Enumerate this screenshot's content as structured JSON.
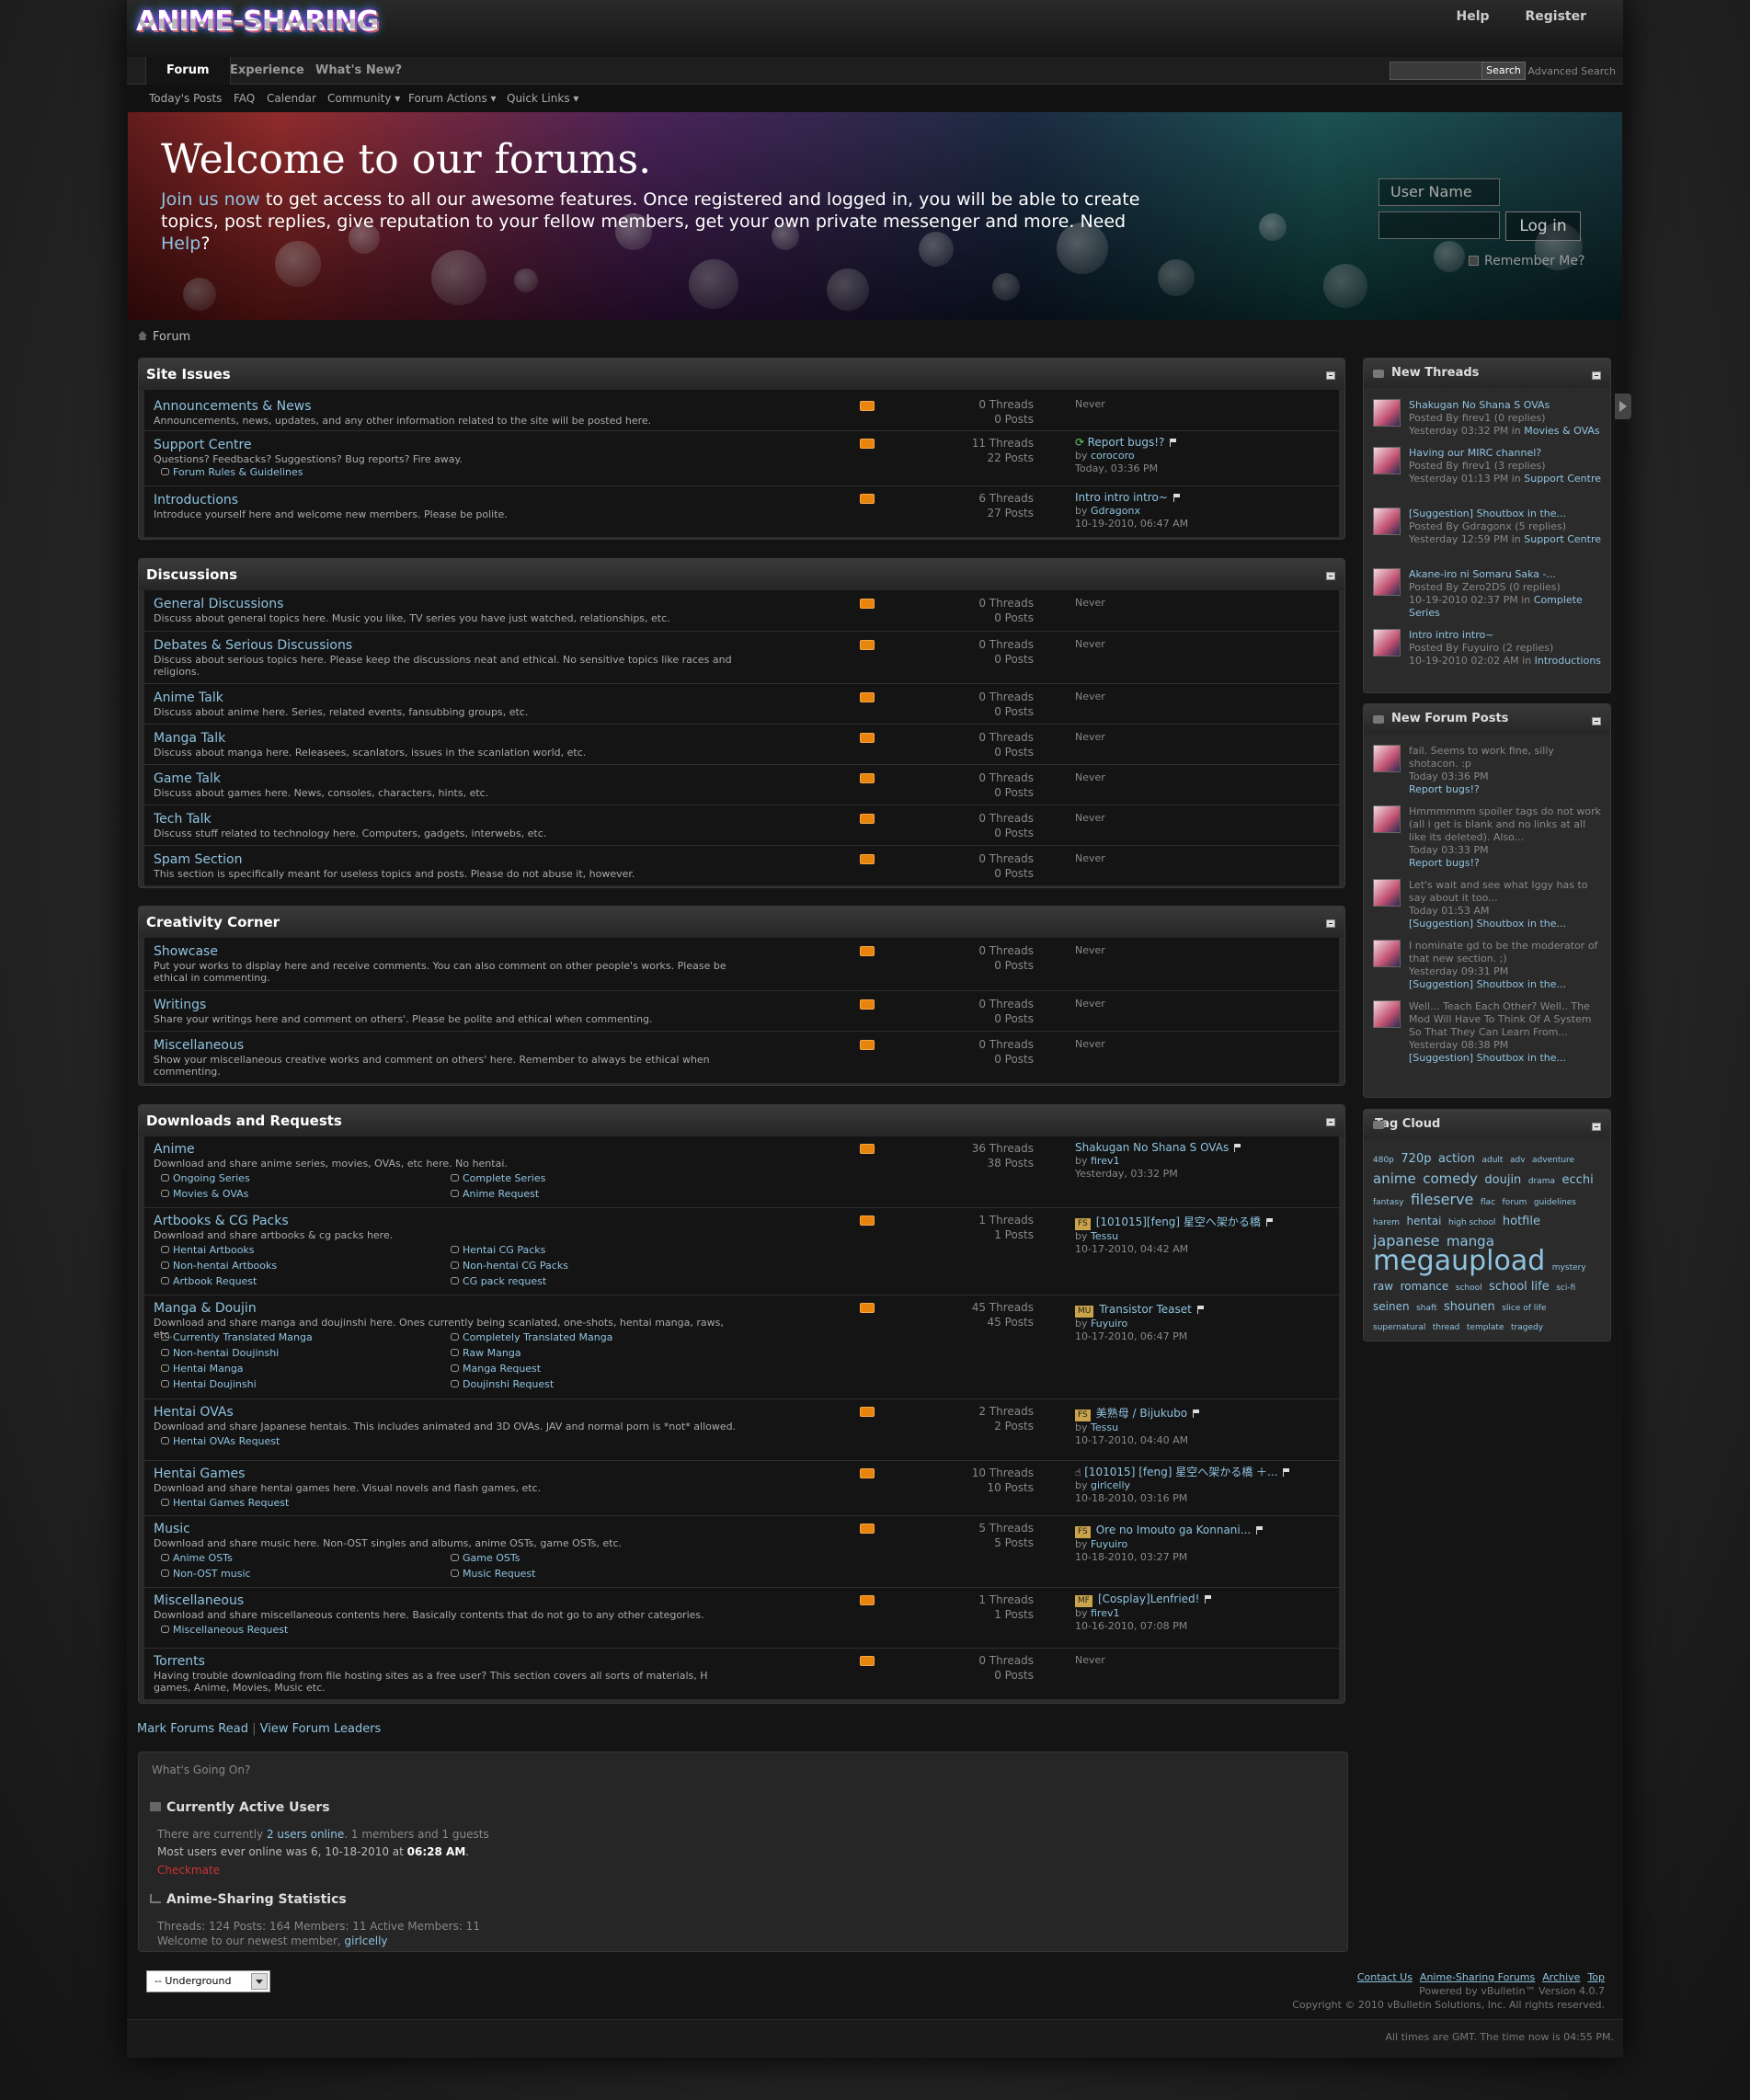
{
  "header": {
    "logo": "ANIME-SHARING",
    "help": "Help",
    "register": "Register"
  },
  "nav": {
    "tabs": [
      {
        "label": "Forum"
      },
      {
        "label": "Experience"
      },
      {
        "label": "What's New?"
      }
    ],
    "search_btn": "Search",
    "advanced": "Advanced Search"
  },
  "subnav": [
    "Today's Posts",
    "FAQ",
    "Calendar",
    "Community ▾",
    "Forum Actions ▾",
    "Quick Links ▾"
  ],
  "banner": {
    "title": "Welcome to our forums.",
    "join": "Join us now",
    "text": " to get access to all our awesome features. Once registered and logged in, you will be able to create topics, post replies, give reputation to your fellow members, get your own private messenger and more. Need ",
    "help": "Help",
    "end": "?",
    "user_placeholder": "User Name",
    "login": "Log in",
    "remember": "Remember Me?"
  },
  "breadcrumb": "Forum",
  "categories": [
    {
      "title": "Site Issues",
      "forums": [
        {
          "name": "Announcements & News",
          "desc": "Announcements, news, updates, and any other information related to the site will be posted here.",
          "threads": "0 Threads",
          "posts": "0 Posts",
          "last": "Never"
        },
        {
          "name": "Support Centre",
          "desc": "Questions? Feedbacks? Suggestions? Bug reports? Fire away.",
          "subs": [
            "Forum Rules & Guidelines"
          ],
          "threads": "11 Threads",
          "posts": "22 Posts",
          "last_title": "Report bugs!?",
          "by": "by ",
          "user": "corocoro",
          "date": "Today, 03:36 PM"
        },
        {
          "name": "Introductions",
          "desc": "Introduce yourself here and welcome new members. Please be polite.",
          "threads": "6 Threads",
          "posts": "27 Posts",
          "last_title": "Intro intro intro~",
          "by": "by ",
          "user": "Gdragonx",
          "date": "10-19-2010, 06:47 AM"
        }
      ]
    },
    {
      "title": "Discussions",
      "forums": [
        {
          "name": "General Discussions",
          "desc": "Discuss about general topics here. Music you like, TV series you have just watched, relationships, etc.",
          "threads": "0 Threads",
          "posts": "0 Posts",
          "last": "Never"
        },
        {
          "name": "Debates & Serious Discussions",
          "desc": "Discuss about serious topics here. Please keep the discussions neat and ethical. No sensitive topics like races and religions.",
          "threads": "0 Threads",
          "posts": "0 Posts",
          "last": "Never"
        },
        {
          "name": "Anime Talk",
          "desc": "Discuss about anime here. Series, related events, fansubbing groups, etc.",
          "threads": "0 Threads",
          "posts": "0 Posts",
          "last": "Never"
        },
        {
          "name": "Manga Talk",
          "desc": "Discuss about manga here. Releasees, scanlators, issues in the scanlation world, etc.",
          "threads": "0 Threads",
          "posts": "0 Posts",
          "last": "Never"
        },
        {
          "name": "Game Talk",
          "desc": "Discuss about games here. News, consoles, characters, hints, etc.",
          "threads": "0 Threads",
          "posts": "0 Posts",
          "last": "Never"
        },
        {
          "name": "Tech Talk",
          "desc": "Discuss stuff related to technology here. Computers, gadgets, interwebs, etc.",
          "threads": "0 Threads",
          "posts": "0 Posts",
          "last": "Never"
        },
        {
          "name": "Spam Section",
          "desc": "This section is specifically meant for useless topics and posts. Please do not abuse it, however.",
          "threads": "0 Threads",
          "posts": "0 Posts",
          "last": "Never"
        }
      ]
    },
    {
      "title": "Creativity Corner",
      "forums": [
        {
          "name": "Showcase",
          "desc": "Put your works to display here and receive comments. You can also comment on other people's works. Please be ethical in commenting.",
          "threads": "0 Threads",
          "posts": "0 Posts",
          "last": "Never"
        },
        {
          "name": "Writings",
          "desc": "Share your writings here and comment on others'. Please be polite and ethical when commenting.",
          "threads": "0 Threads",
          "posts": "0 Posts",
          "last": "Never"
        },
        {
          "name": "Miscellaneous",
          "desc": "Show your miscellaneous creative works and comment on others' here. Remember to always be ethical when commenting.",
          "threads": "0 Threads",
          "posts": "0 Posts",
          "last": "Never"
        }
      ]
    },
    {
      "title": "Downloads and Requests",
      "forums": [
        {
          "name": "Anime",
          "desc": "Download and share anime series, movies, OVAs, etc here. No hentai.",
          "subs": [
            "Ongoing Series",
            "Complete Series",
            "Movies & OVAs",
            "Anime Request"
          ],
          "threads": "36 Threads",
          "posts": "38 Posts",
          "last_title": "Shakugan No Shana S OVAs",
          "by": "by ",
          "user": "firev1",
          "date": "Yesterday, 03:32 PM"
        },
        {
          "name": "Artbooks & CG Packs",
          "desc": "Download and share artbooks & cg packs here.",
          "subs": [
            "Hentai Artbooks",
            "Hentai CG Packs",
            "Non-hentai Artbooks",
            "Non-hentai CG Packs",
            "Artbook Request",
            "CG pack request"
          ],
          "threads": "1 Threads",
          "posts": "1 Posts",
          "prefix": "FS",
          "last_title": "[101015][feng] 星空へ架かる橋",
          "by": "by ",
          "user": "Tessu",
          "date": "10-17-2010, 04:42 AM"
        },
        {
          "name": "Manga & Doujin",
          "desc": "Download and share manga and doujinshi here. Ones currently being scanlated, one-shots, hentai manga, raws, etc.",
          "subs": [
            "Currently Translated Manga",
            "Completely Translated Manga",
            "Non-hentai Doujinshi",
            "Raw Manga",
            "Hentai Manga",
            "Manga Request",
            "Hentai Doujinshi",
            "Doujinshi Request"
          ],
          "threads": "45 Threads",
          "posts": "45 Posts",
          "prefix": "MU",
          "last_title": "Transistor Teaset",
          "by": "by ",
          "user": "Fuyuiro",
          "date": "10-17-2010, 06:47 PM"
        },
        {
          "name": "Hentai OVAs",
          "desc": "Download and share Japanese hentais. This includes animated and 3D OVAs. JAV and normal porn is *not* allowed.",
          "subs": [
            "Hentai OVAs Request"
          ],
          "threads": "2 Threads",
          "posts": "2 Posts",
          "prefix": "FS",
          "last_title": "美熟母 / Bijukubo",
          "by": "by ",
          "user": "Tessu",
          "date": "10-17-2010, 04:40 AM"
        },
        {
          "name": "Hentai Games",
          "desc": "Download and share hentai games here. Visual novels and flash games, etc.",
          "subs": [
            "Hentai Games Request"
          ],
          "threads": "10 Threads",
          "posts": "10 Posts",
          "last_title": "[101015] [feng] 星空へ架かる橋 ＋...",
          "by": "by ",
          "user": "girlcelly",
          "date": "10-18-2010, 03:16 PM"
        },
        {
          "name": "Music",
          "desc": "Download and share music here. Non-OST singles and albums, anime OSTs, game OSTs, etc.",
          "subs": [
            "Anime OSTs",
            "Game OSTs",
            "Non-OST music",
            "Music Request"
          ],
          "threads": "5 Threads",
          "posts": "5 Posts",
          "prefix": "FS",
          "last_title": "Ore no Imouto ga Konnani...",
          "by": "by ",
          "user": "Fuyuiro",
          "date": "10-18-2010, 03:27 PM"
        },
        {
          "name": "Miscellaneous",
          "desc": "Download and share miscellaneous contents here. Basically contents that do not go to any other categories.",
          "subs": [
            "Miscellaneous Request"
          ],
          "threads": "1 Threads",
          "posts": "1 Posts",
          "prefix": "MF",
          "last_title": "[Cosplay]Lenfried!",
          "by": "by ",
          "user": "firev1",
          "date": "10-16-2010, 07:08 PM"
        },
        {
          "name": "Torrents",
          "desc": "Having trouble downloading from file hosting sites as a free user? This section covers all sorts of materials, H games, Anime, Movies, Music etc.",
          "threads": "0 Threads",
          "posts": "0 Posts",
          "last": "Never"
        }
      ]
    }
  ],
  "sidebar": {
    "new_threads": {
      "title": "New Threads",
      "items": [
        {
          "title": "Shakugan No Shana S OVAs",
          "meta": "Posted By firev1 (0 replies)",
          "date": "Yesterday 03:32 PM in ",
          "where": "Movies & OVAs"
        },
        {
          "title": "Having our MIRC channel?",
          "meta": "Posted By firev1 (3 replies)",
          "date": "Yesterday 01:13 PM in ",
          "where": "Support Centre"
        },
        {
          "title": "[Suggestion] Shoutbox in the...",
          "meta": "Posted By Gdragonx (5 replies)",
          "date": "Yesterday 12:59 PM in ",
          "where": "Support Centre"
        },
        {
          "title": "Akane-iro ni Somaru Saka -...",
          "meta": "Posted By Zero2DS (0 replies)",
          "date": "10-19-2010 02:37 PM in ",
          "where": "Complete Series"
        },
        {
          "title": "Intro intro intro~",
          "meta": "Posted By Fuyuiro (2 replies)",
          "date": "10-19-2010 02:02 AM in ",
          "where": "Introductions"
        }
      ]
    },
    "new_posts": {
      "title": "New Forum Posts",
      "items": [
        {
          "text": "fail. Seems to work fine, silly shotacon. :p",
          "date": "Today 03:36 PM",
          "where": "Report bugs!?"
        },
        {
          "text": "Hmmmmmm spoiler tags do not work (all i get is blank and no links at all like its deleted). Also...",
          "date": "Today 03:33 PM",
          "where": "Report bugs!?"
        },
        {
          "text": "Let's wait and see what Iggy has to say about it too...",
          "date": "Today 01:53 AM",
          "where": "[Suggestion] Shoutbox in the..."
        },
        {
          "text": "I nominate gd to be the moderator of that new section. ;)",
          "date": "Yesterday 09:31 PM",
          "where": "[Suggestion] Shoutbox in the..."
        },
        {
          "text": "Well... Teach Each Other? Well.. The Mod Will Have To Think Of A System So That They Can Learn From...",
          "date": "Yesterday 08:38 PM",
          "where": "[Suggestion] Shoutbox in the..."
        }
      ]
    },
    "tag_cloud": {
      "title": "Tag Cloud",
      "tags": [
        {
          "t": "480p",
          "s": 9
        },
        {
          "t": "720p",
          "s": 13
        },
        {
          "t": "action",
          "s": 13
        },
        {
          "t": "adult",
          "s": 9
        },
        {
          "t": "adv",
          "s": 9
        },
        {
          "t": "adventure",
          "s": 9
        },
        {
          "t": "anime",
          "s": 15
        },
        {
          "t": "comedy",
          "s": 15
        },
        {
          "t": "doujin",
          "s": 13
        },
        {
          "t": "drama",
          "s": 9
        },
        {
          "t": "ecchi",
          "s": 13
        },
        {
          "t": "fantasy",
          "s": 9
        },
        {
          "t": "fileserve",
          "s": 16
        },
        {
          "t": "flac",
          "s": 9
        },
        {
          "t": "forum",
          "s": 9
        },
        {
          "t": "guidelines",
          "s": 9
        },
        {
          "t": "harem",
          "s": 9
        },
        {
          "t": "hentai",
          "s": 12
        },
        {
          "t": "high school",
          "s": 9
        },
        {
          "t": "hotfile",
          "s": 13
        },
        {
          "t": "japanese",
          "s": 16
        },
        {
          "t": "manga",
          "s": 15
        },
        {
          "t": "megaupload",
          "s": 30
        },
        {
          "t": "mystery",
          "s": 9
        },
        {
          "t": "raw",
          "s": 12
        },
        {
          "t": "romance",
          "s": 12
        },
        {
          "t": "school",
          "s": 9
        },
        {
          "t": "school life",
          "s": 13
        },
        {
          "t": "sci-fi",
          "s": 9
        },
        {
          "t": "seinen",
          "s": 12
        },
        {
          "t": "shaft",
          "s": 9
        },
        {
          "t": "shounen",
          "s": 13
        },
        {
          "t": "slice of life",
          "s": 9
        },
        {
          "t": "supernatural",
          "s": 9
        },
        {
          "t": "thread",
          "s": 9
        },
        {
          "t": "template",
          "s": 9
        },
        {
          "t": "tragedy",
          "s": 9
        }
      ]
    }
  },
  "footer": {
    "mark_read": "Mark Forums Read",
    "sep": " | ",
    "leaders": "View Forum Leaders",
    "going_on": "What's Going On?",
    "active_title": "Currently Active Users",
    "active_1a": "There are currently ",
    "active_1b": "2 users online",
    "active_1c": ". 1 members and 1 guests",
    "active_2a": "Most users ever online was 6, 10-18-2010 at ",
    "active_2b": "06:28 AM",
    "active_2c": ".",
    "active_user": "Checkmate",
    "stats_title": "Anime-Sharing Statistics",
    "stats_line": "Threads: 124   Posts: 164   Members: 11   Active Members: 11",
    "newest_a": "Welcome to our newest member, ",
    "newest_b": "girlcelly",
    "style_select": "-- Underground",
    "links": [
      "Contact Us",
      "Anime-Sharing Forums",
      "Archive",
      "Top"
    ],
    "powered": "Powered by vBulletin™ Version 4.0.7",
    "copyright": "Copyright © 2010 vBulletin Solutions, Inc. All rights reserved.",
    "timezone": "All times are GMT. The time now is 04:55 PM."
  },
  "colors": {
    "link": "#8fc3e0",
    "rss": "#e8830c",
    "prefix": "#caa34a",
    "text": "#9a9a9a"
  }
}
